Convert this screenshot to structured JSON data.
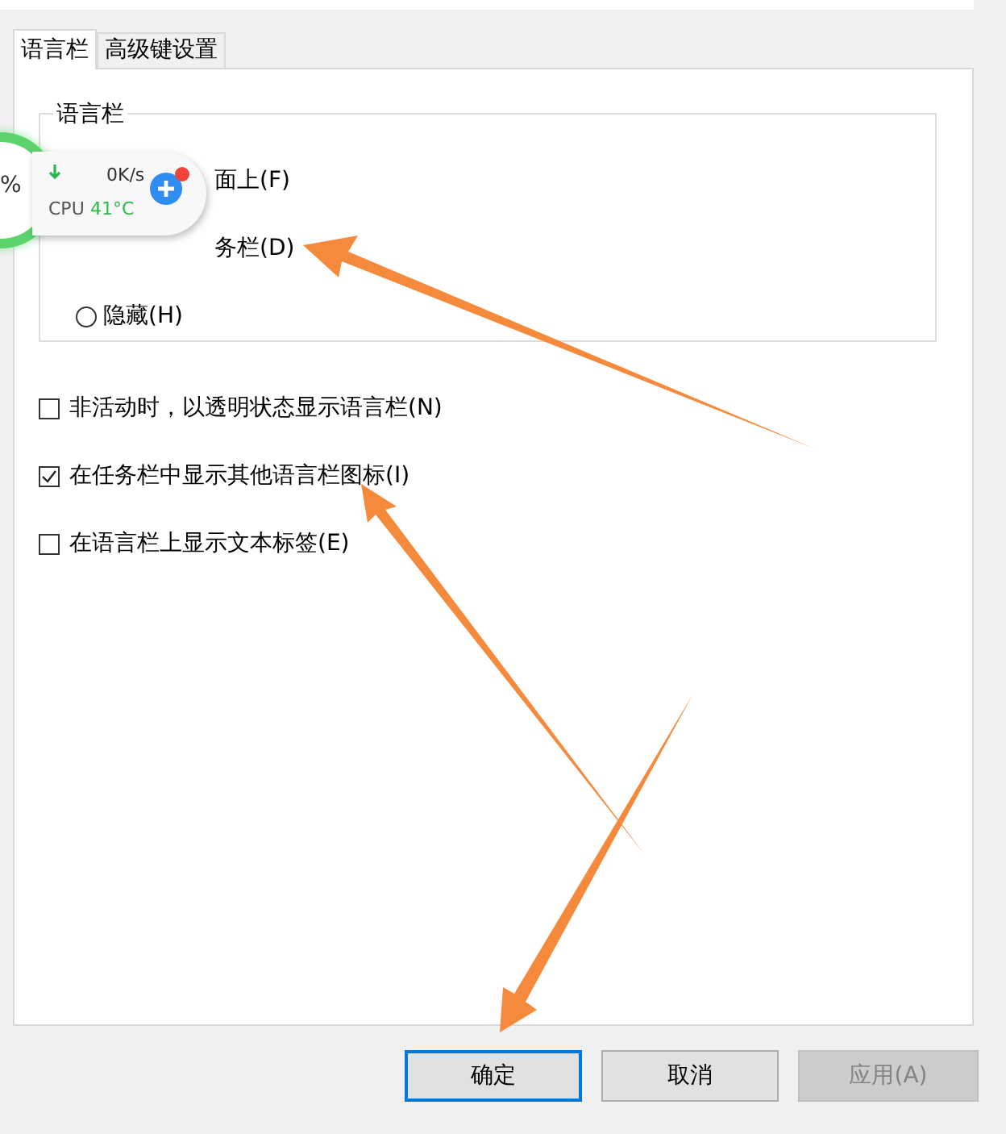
{
  "tabs": [
    {
      "label": "语言栏",
      "selected": true
    },
    {
      "label": "高级键设置",
      "selected": false
    }
  ],
  "language_bar_group": {
    "title": "语言栏",
    "options": [
      {
        "kind": "covered",
        "label": "面上(F)"
      },
      {
        "kind": "covered",
        "label": "务栏(D)"
      },
      {
        "kind": "radio",
        "label": "隐藏(H)",
        "selected": false
      }
    ]
  },
  "checkboxes": [
    {
      "label": "非活动时，以透明状态显示语言栏(N)",
      "checked": false
    },
    {
      "label": "在任务栏中显示其他语言栏图标(I)",
      "checked": true
    },
    {
      "label": "在语言栏上显示文本标签(E)",
      "checked": false
    }
  ],
  "buttons": [
    {
      "label": "确定",
      "default": true,
      "disabled": false
    },
    {
      "label": "取消",
      "default": false,
      "disabled": false
    },
    {
      "label": "应用(A)",
      "default": false,
      "disabled": true
    }
  ],
  "monitor_widget": {
    "percent_sign": "%",
    "speed": "0K/s",
    "cpu_label": "CPU",
    "cpu_temp": "41°C"
  }
}
